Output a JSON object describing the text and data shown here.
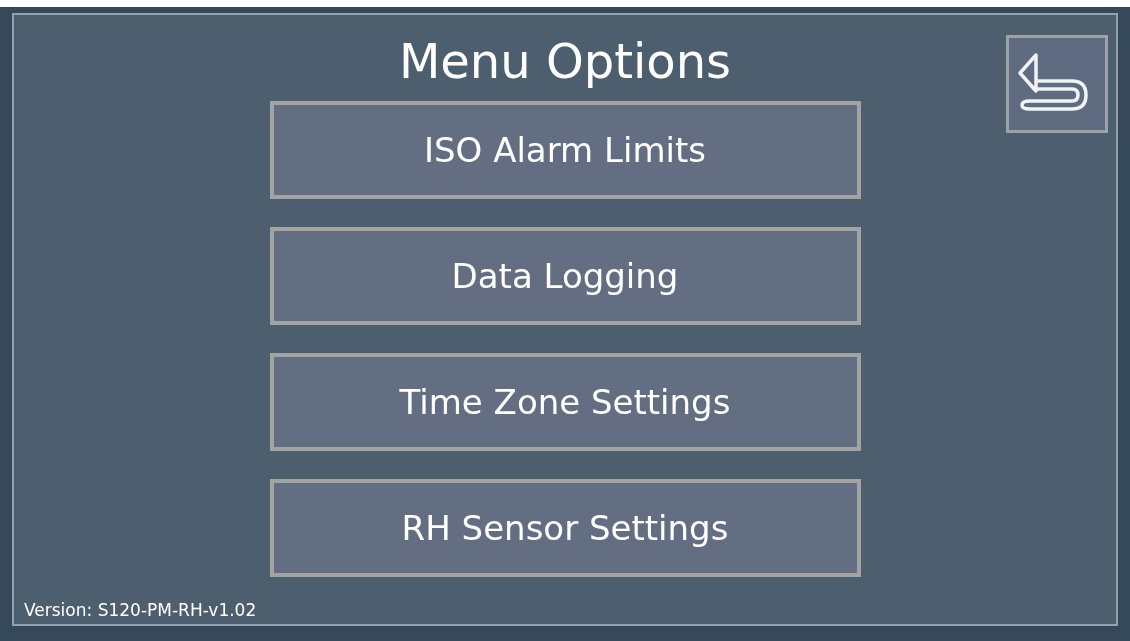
{
  "title": "Menu Options",
  "buttons": [
    {
      "label": "ISO Alarm Limits"
    },
    {
      "label": "Data Logging"
    },
    {
      "label": "Time Zone Settings"
    },
    {
      "label": "RH Sensor Settings"
    }
  ],
  "version": "Version: S120-PM-RH-v1.02"
}
